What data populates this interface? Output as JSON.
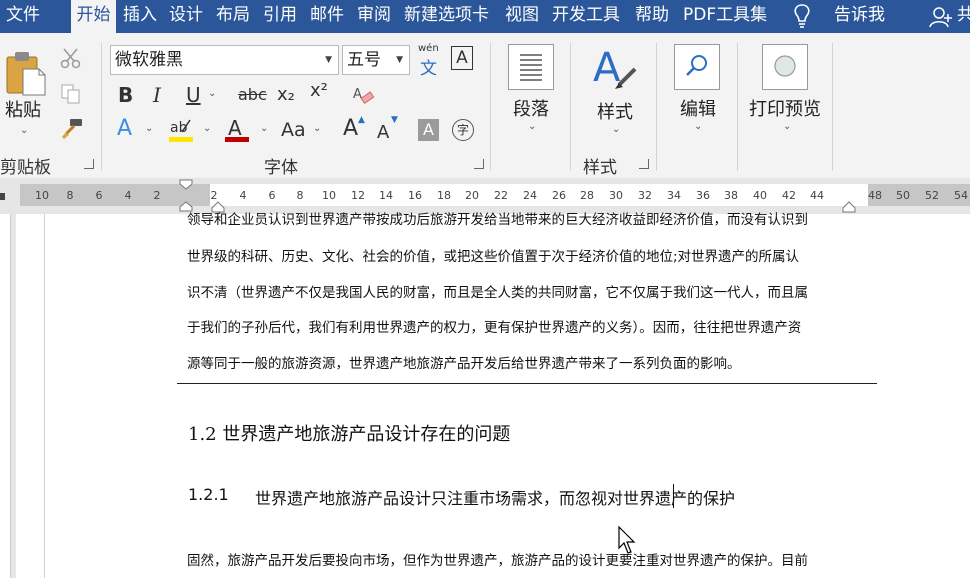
{
  "menu": {
    "tabs": [
      "文件",
      "开始",
      "插入",
      "设计",
      "布局",
      "引用",
      "邮件",
      "审阅",
      "新建选项卡",
      "视图",
      "开发工具",
      "帮助",
      "PDF工具集"
    ],
    "active": "开始",
    "tell_me": "告诉我",
    "share_partial": "共"
  },
  "ribbon": {
    "clipboard": {
      "paste": "粘贴",
      "label": "剪贴板"
    },
    "font": {
      "label": "字体",
      "font_name": "微软雅黑",
      "font_size": "五号",
      "phonetic_top": "wén",
      "phonetic_bottom": "文",
      "border_char": "A",
      "bold": "B",
      "italic": "I",
      "underline": "U",
      "strike": "abc",
      "subscript": "x₂",
      "superscript": "x²",
      "case": "Aa",
      "grow": "A",
      "shrink": "A",
      "shading": "A",
      "enclose": "字"
    },
    "paragraph": {
      "label": "段落"
    },
    "styles": {
      "label": "样式",
      "group_label": "样式"
    },
    "editing": {
      "label": "编辑"
    },
    "print": {
      "label": "打印预览"
    }
  },
  "ruler": {
    "ticks": [
      "10",
      "8",
      "6",
      "4",
      "2",
      "2",
      "4",
      "6",
      "8",
      "10",
      "12",
      "14",
      "16",
      "18",
      "20",
      "22",
      "24",
      "26",
      "28",
      "30",
      "32",
      "34",
      "36",
      "38",
      "40",
      "42",
      "44",
      "48",
      "50",
      "52",
      "54"
    ]
  },
  "document": {
    "lines": [
      "领导和企业员认识到世界遗产带按成功后旅游开发给当地带来的巨大经济收益即经济价值，而没有认识到",
      "世界级的科研、历史、文化、社会的价值，或把这些价值置于次于经济价值的地位;对世界遗产的所属认",
      "识不清（世界遗产不仅是我国人民的财富，而且是全人类的共同财富，它不仅属于我们这一代人，而且属",
      "于我们的子孙后代，我们有利用世界遗产的权力，更有保护世界遗产的义务）。因而，往往把世界遗产资",
      "源等同于一般的旅游资源，世界遗产地旅游产品开发后给世界遗产带来了一系列负面的影响。"
    ],
    "heading2": "1.2  世界遗产地旅游产品设计存在的问题",
    "heading3_num": "1.2.1",
    "heading3": "世界遗产地旅游产品设计只注重市场需求，而忽视对世界遗产的保护",
    "last_line": "固然，旅游产品开发后要投向市场，但作为世界遗产，旅游产品的设计更要注重对世界遗产的保护。目前"
  }
}
